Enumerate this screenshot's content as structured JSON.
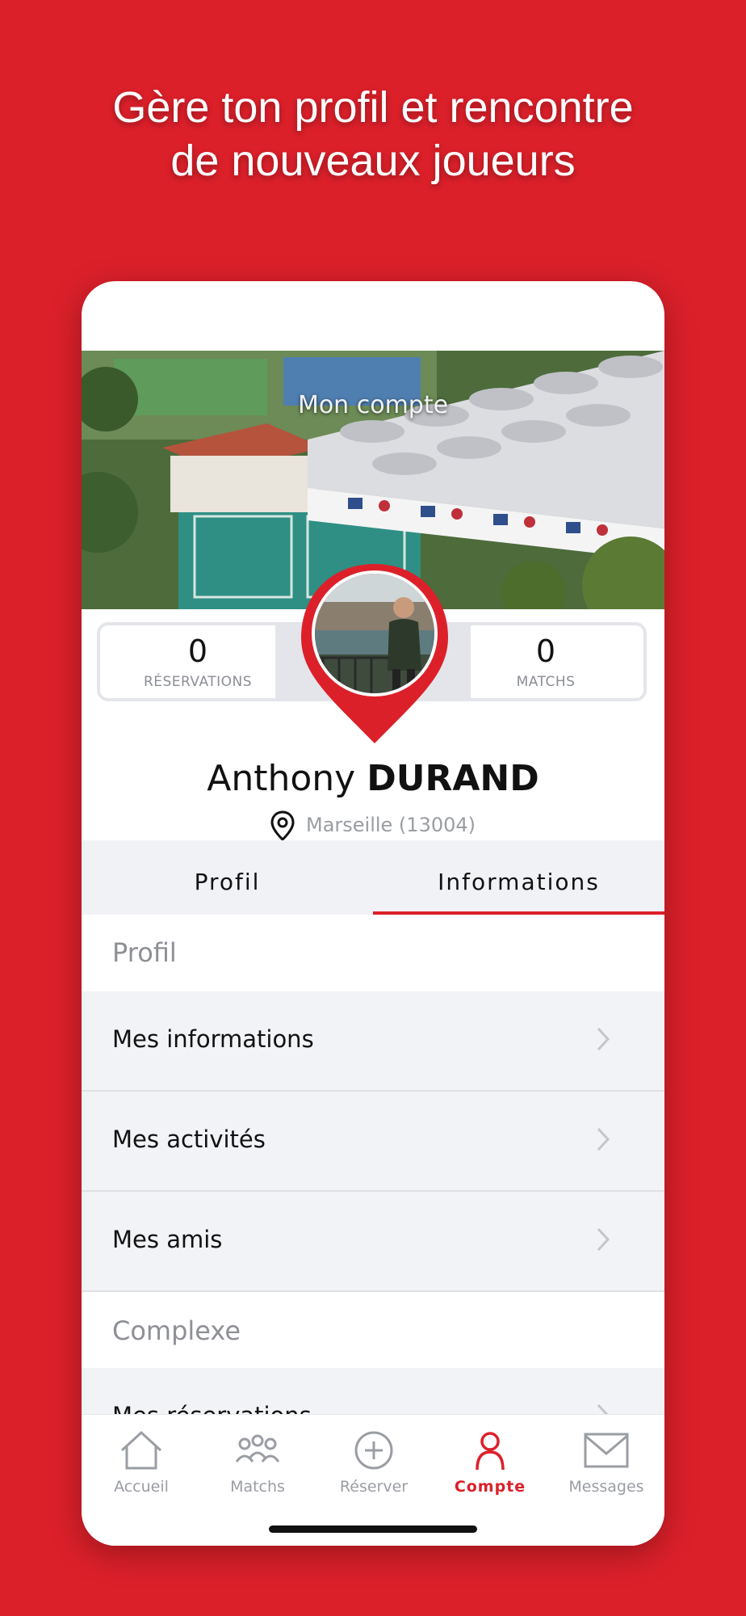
{
  "headline": {
    "line1": "Gère ton profil et rencontre",
    "line2": "de nouveaux joueurs"
  },
  "colors": {
    "accent": "#DC202A",
    "list_bg": "#F2F3F6",
    "muted": "#9a9da3"
  },
  "screen": {
    "title": "Mon compte",
    "stats": {
      "reservations": {
        "value": "0",
        "label": "RÉSERVATIONS"
      },
      "matchs": {
        "value": "0",
        "label": "MATCHS"
      }
    },
    "user": {
      "first_name": "Anthony",
      "last_name": "DURAND",
      "location": "Marseille (13004)"
    },
    "tabs": [
      {
        "label": "Profil",
        "active": false
      },
      {
        "label": "Informations",
        "active": true
      }
    ],
    "sections": [
      {
        "title": "Profil",
        "items": [
          "Mes informations",
          "Mes activités",
          "Mes amis"
        ]
      },
      {
        "title": "Complexe",
        "items": [
          "Mes réservations"
        ]
      }
    ]
  },
  "tabbar": {
    "items": [
      {
        "label": "Accueil",
        "icon": "home-icon",
        "active": false
      },
      {
        "label": "Matchs",
        "icon": "players-icon",
        "active": false
      },
      {
        "label": "Réserver",
        "icon": "plus-circle-icon",
        "active": false
      },
      {
        "label": "Compte",
        "icon": "user-icon",
        "active": true
      },
      {
        "label": "Messages",
        "icon": "mail-icon",
        "active": false
      }
    ]
  }
}
